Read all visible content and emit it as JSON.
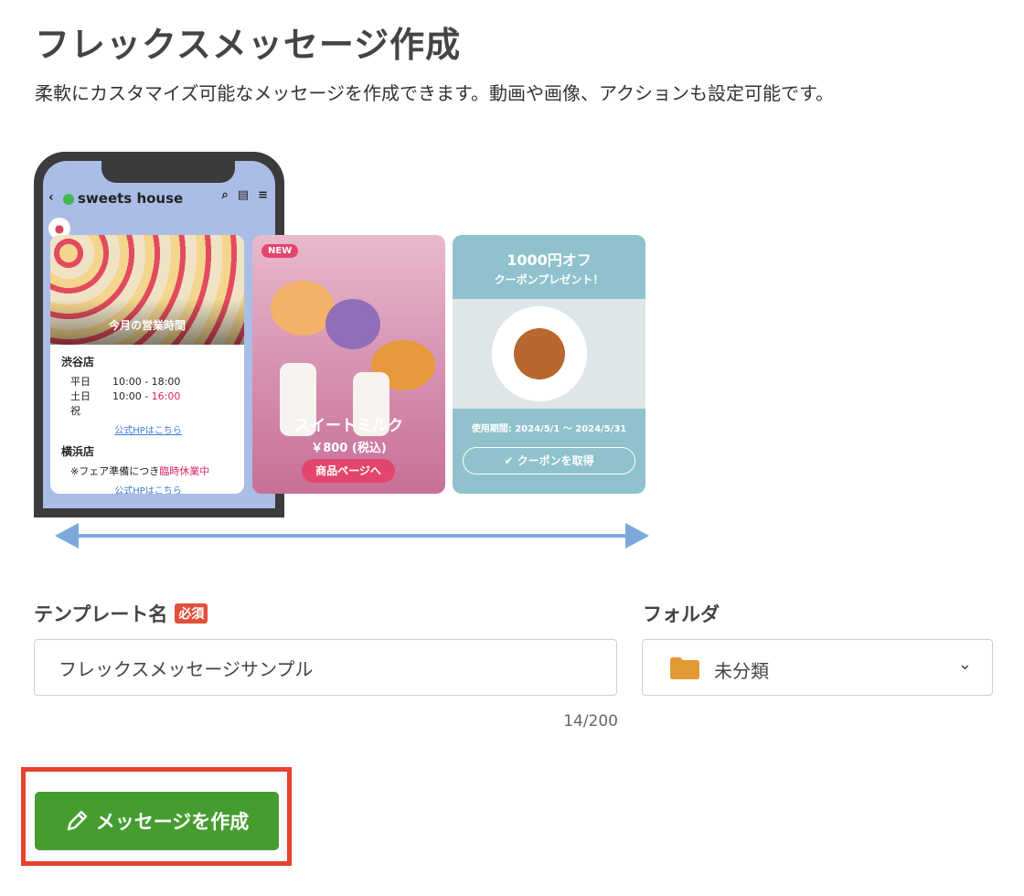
{
  "header": {
    "title": "フレックスメッセージ作成",
    "description": "柔軟にカスタマイズ可能なメッセージを作成できます。動画や画像、アクションも設定可能です。"
  },
  "preview": {
    "account_name": "sweets house",
    "card1": {
      "photo_caption": "今月の営業時間",
      "store1": {
        "name": "渋谷店",
        "rows": [
          {
            "label": "平日",
            "value": "10:00 - 18:00",
            "value_extra": ""
          },
          {
            "label": "土日祝",
            "value": "10:00 - ",
            "value_extra": "16:00"
          }
        ],
        "link": "公式HPはこちら"
      },
      "store2": {
        "name": "横浜店",
        "note": "※フェア準備につき",
        "note_red": "臨時休業中",
        "link": "公式HPはこちら"
      }
    },
    "card2": {
      "badge": "NEW",
      "title": "スイートミルク",
      "price": "￥800 (税込)",
      "button": "商品ページへ"
    },
    "card3": {
      "headline": "1000円オフ",
      "subhead": "クーポンプレゼント！",
      "period": "使用期間: 2024/5/1 〜 2024/5/31",
      "button": "✔ クーポンを取得"
    }
  },
  "form": {
    "template_label": "テンプレート名",
    "required_badge": "必須",
    "template_value": "フレックスメッセージサンプル",
    "counter": "14/200",
    "folder_label": "フォルダ",
    "folder_value": "未分類"
  },
  "actions": {
    "create_label": "メッセージを作成"
  },
  "colors": {
    "create_button": "#459d2f",
    "highlight": "#e8412d",
    "required": "#e0503a",
    "arrow": "#7aa9da"
  }
}
